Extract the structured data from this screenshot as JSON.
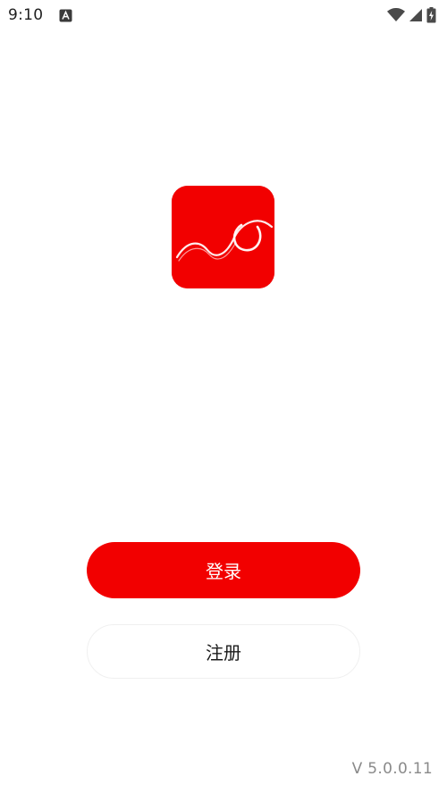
{
  "status_bar": {
    "time": "9:10",
    "notification_icon": "a-letter-icon",
    "icons": [
      "wifi-icon",
      "signal-icon",
      "battery-charging-icon"
    ]
  },
  "logo": {
    "icon": "app-logo-icon",
    "background": "#f20000"
  },
  "buttons": {
    "login_label": "登录",
    "register_label": "注册"
  },
  "version": "V 5.0.0.11",
  "colors": {
    "accent": "#f20000",
    "text": "#1b1b1b",
    "muted": "#8a8a8a"
  }
}
